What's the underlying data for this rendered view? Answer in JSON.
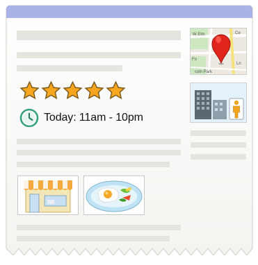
{
  "listing": {
    "rating_stars": 5,
    "hours_text": "Today: 11am - 10pm"
  },
  "map": {
    "street_labels": [
      "W Elm",
      "Ce",
      "Fo",
      "coln Park",
      "Ln"
    ],
    "pin_color": "#e0241b"
  },
  "colors": {
    "header_bar": "#aab3e8",
    "placeholder": "#e6e4de",
    "star_fill": "#f7a61d",
    "clock_ring": "#33a27c"
  },
  "icons": [
    "map-pin-icon",
    "building-icon",
    "person-icon",
    "clock-icon",
    "star-icon",
    "storefront-icon",
    "food-plate-icon"
  ]
}
